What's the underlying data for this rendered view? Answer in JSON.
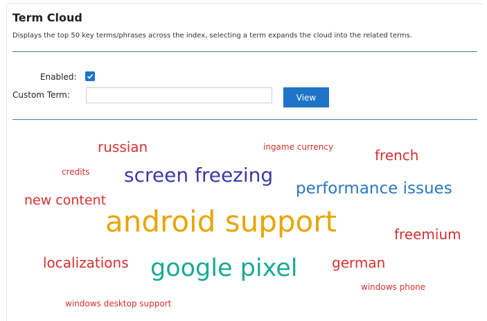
{
  "header": {
    "title": "Term Cloud",
    "description": "Displays the top 50 key terms/phrases across the index, selecting a term expands the cloud into the related terms."
  },
  "form": {
    "enabled_label": "Enabled:",
    "enabled_checked": true,
    "custom_term_label": "Custom Term:",
    "custom_term_value": "",
    "custom_term_placeholder": "",
    "view_button_label": "View"
  },
  "colors": {
    "accent": "#1e74c6",
    "divider": "#3b7ea6",
    "red": "#d62f2f",
    "purple": "#3b3aa3",
    "blue": "#2a78bf",
    "orange": "#e7a600",
    "teal": "#18aa95"
  },
  "cloud": {
    "terms": [
      {
        "text": "russian",
        "color": "red"
      },
      {
        "text": "ingame currency",
        "color": "red"
      },
      {
        "text": "french",
        "color": "red"
      },
      {
        "text": "credits",
        "color": "red"
      },
      {
        "text": "screen freezing",
        "color": "purple"
      },
      {
        "text": "performance issues",
        "color": "blue"
      },
      {
        "text": "new content",
        "color": "red"
      },
      {
        "text": "android support",
        "color": "orange"
      },
      {
        "text": "freemium",
        "color": "red"
      },
      {
        "text": "localizations",
        "color": "red"
      },
      {
        "text": "google pixel",
        "color": "teal"
      },
      {
        "text": "german",
        "color": "red"
      },
      {
        "text": "windows phone",
        "color": "red"
      },
      {
        "text": "windows desktop support",
        "color": "red"
      }
    ]
  }
}
